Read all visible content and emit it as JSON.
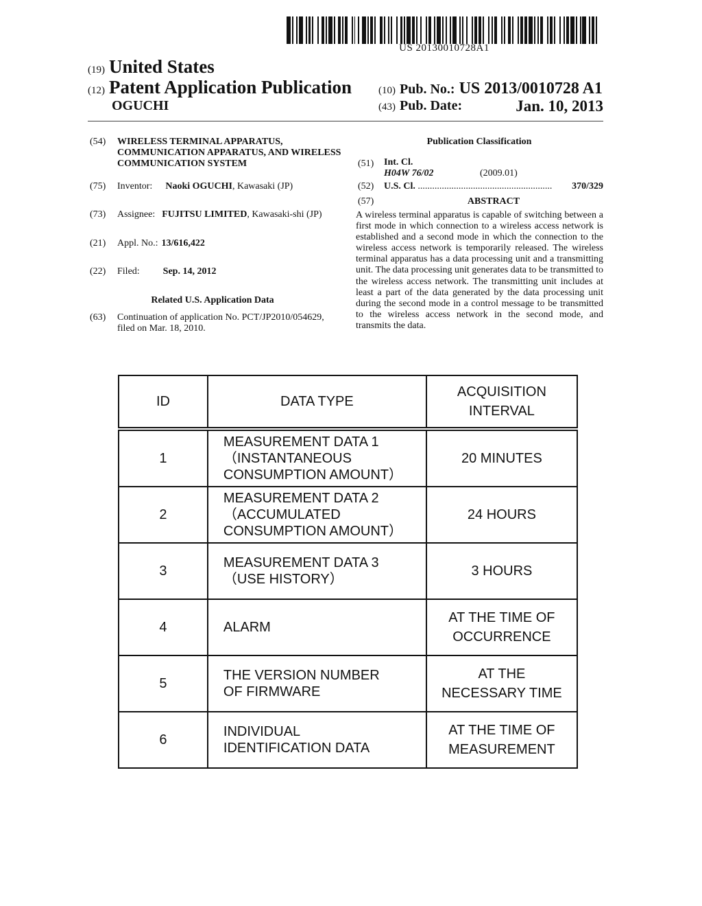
{
  "barcode": {
    "text": "US 20130010728A1"
  },
  "header": {
    "country_code": "(19)",
    "country": "United States",
    "pubtype_code": "(12)",
    "pubtype": "Patent Application Publication",
    "inventor_short": "OGUCHI",
    "pubno_code": "(10)",
    "pubno_label": "Pub. No.:",
    "pubno_value": "US 2013/0010728 A1",
    "pubdate_code": "(43)",
    "pubdate_label": "Pub. Date:",
    "pubdate_value": "Jan. 10, 2013"
  },
  "biblio": {
    "title_code": "(54)",
    "title": "WIRELESS TERMINAL APPARATUS, COMMUNICATION APPARATUS, AND WIRELESS COMMUNICATION SYSTEM",
    "inventor_code": "(75)",
    "inventor_label": "Inventor:",
    "inventor_name": "Naoki OGUCHI",
    "inventor_location": ", Kawasaki (JP)",
    "assignee_code": "(73)",
    "assignee_label": "Assignee:",
    "assignee_name": "FUJITSU LIMITED",
    "assignee_location": ", Kawasaki-shi (JP)",
    "appl_code": "(21)",
    "appl_label": "Appl. No.:",
    "appl_value": "13/616,422",
    "filed_code": "(22)",
    "filed_label": "Filed:",
    "filed_value": "Sep. 14, 2012",
    "related_heading": "Related U.S. Application Data",
    "related_code": "(63)",
    "related_text": "Continuation of application No. PCT/JP2010/054629, filed on Mar. 18, 2010."
  },
  "classification": {
    "heading": "Publication Classification",
    "intcl_code": "(51)",
    "intcl_label": "Int. Cl.",
    "intcl_value": "H04W 76/02",
    "intcl_version": "(2009.01)",
    "uscl_code": "(52)",
    "uscl_label": "U.S. Cl.",
    "uscl_dots": "........................................................",
    "uscl_value": "370/329"
  },
  "abstract": {
    "code": "(57)",
    "heading": "ABSTRACT",
    "text": "A wireless terminal apparatus is capable of switching between a first mode in which connection to a wireless access network is established and a second mode in which the connection to the wireless access network is temporarily released. The wireless terminal apparatus has a data processing unit and a transmitting unit. The data processing unit generates data to be transmitted to the wireless access network. The transmitting unit includes at least a part of the data generated by the data processing unit during the second mode in a control message to be transmitted to the wireless access network in the second mode, and transmits the data."
  },
  "table": {
    "headers": [
      "ID",
      "DATA TYPE",
      "ACQUISITION\nINTERVAL"
    ],
    "rows": [
      {
        "id": "1",
        "type": "MEASUREMENT DATA 1\n（INSTANTANEOUS\nCONSUMPTION AMOUNT）",
        "interval": "20 MINUTES"
      },
      {
        "id": "2",
        "type": "MEASUREMENT DATA 2\n（ACCUMULATED\nCONSUMPTION AMOUNT）",
        "interval": "24 HOURS"
      },
      {
        "id": "3",
        "type": "MEASUREMENT DATA 3\n（USE HISTORY）",
        "interval": "3 HOURS"
      },
      {
        "id": "4",
        "type": "ALARM",
        "interval": "AT THE TIME OF\nOCCURRENCE"
      },
      {
        "id": "5",
        "type": "THE VERSION NUMBER\nOF FIRMWARE",
        "interval": "AT THE\nNECESSARY TIME"
      },
      {
        "id": "6",
        "type": "INDIVIDUAL\nIDENTIFICATION DATA",
        "interval": "AT THE TIME OF\nMEASUREMENT"
      }
    ]
  }
}
